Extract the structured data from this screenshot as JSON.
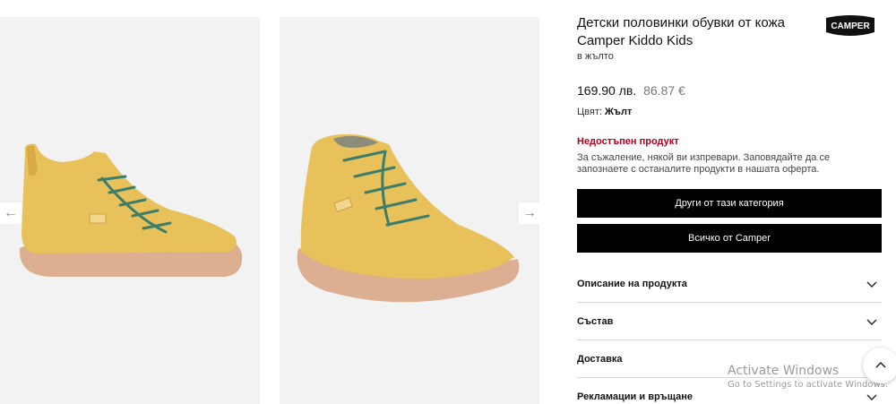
{
  "product": {
    "title": "Детски половинки обувки от кожа Camper Kiddo Kids",
    "color_subtitle": "в жълто",
    "price_main": "169.90 лв.",
    "price_alt": "86.87 €",
    "color_label": "Цвят:",
    "color_value": "Жълт",
    "unavailable_label": "Недостъпен продукт",
    "unavailable_message": "За съжаление, някой ви изпревари. Заповядайте да се запознаете с останалите продукти в нашата оферта."
  },
  "brand": {
    "logo_text": "CAMPER"
  },
  "gallery": {
    "image_1_icon": "shoe-side-view",
    "image_2_icon": "shoe-angle-view",
    "prev_arrow": "←",
    "next_arrow": "→",
    "shoe_color": "#e8bf5a",
    "sole_color": "#d9a98d"
  },
  "buttons": {
    "category": "Други от тази категория",
    "brand": "Всичко от Camper"
  },
  "accordion": [
    {
      "label": "Описание на продукта"
    },
    {
      "label": "Състав"
    },
    {
      "label": "Доставка"
    },
    {
      "label": "Рекламации и връщане"
    }
  ],
  "watermark": {
    "title": "Activate Windows",
    "subtitle": "Go to Settings to activate Windows."
  },
  "colors": {
    "accent_unavailable": "#b00020",
    "button_bg": "#000000"
  }
}
